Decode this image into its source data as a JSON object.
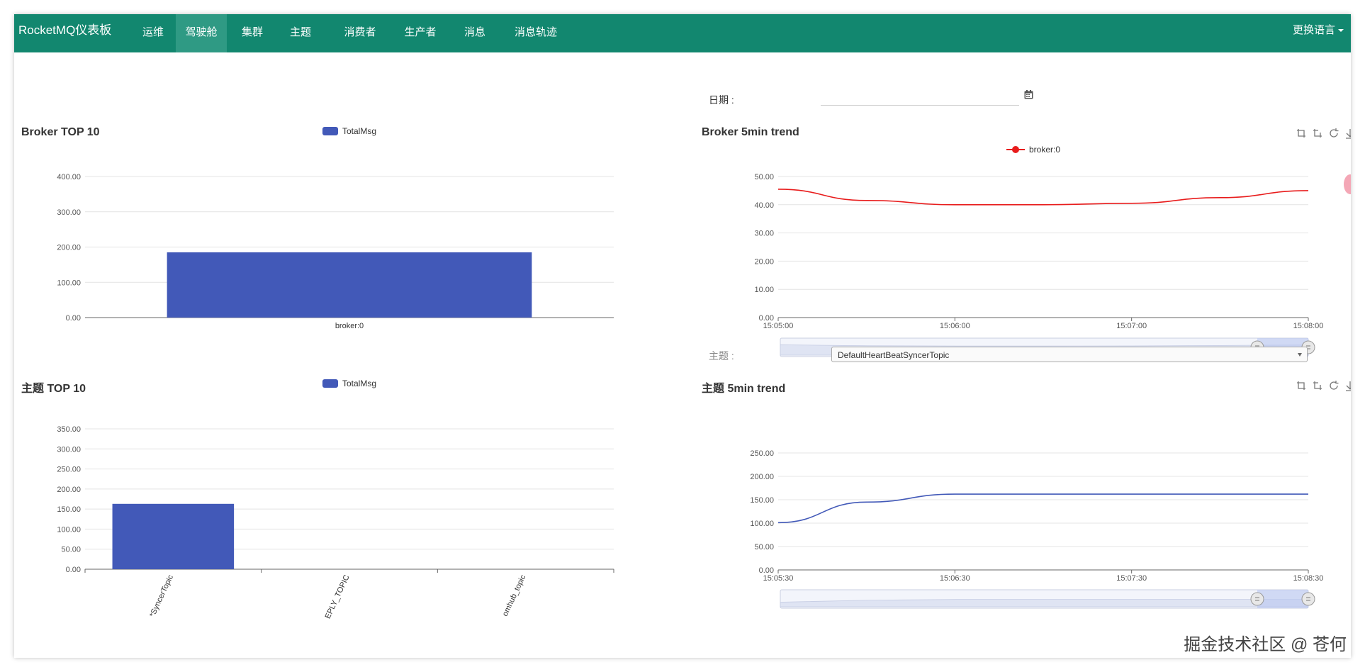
{
  "navbar": {
    "brand": "RocketMQ仪表板",
    "items": [
      {
        "label": "运维"
      },
      {
        "label": "驾驶舱",
        "active": true
      },
      {
        "label": "集群"
      },
      {
        "label": "主题"
      },
      {
        "label": "消费者"
      },
      {
        "label": "生产者"
      },
      {
        "label": "消息"
      },
      {
        "label": "消息轨迹"
      }
    ],
    "language_label": "更换语言"
  },
  "date_filter": {
    "label": "日期 :",
    "value": "",
    "icon": "calendar-icon"
  },
  "topic_filter": {
    "label": "主题 :",
    "selected": "DefaultHeartBeatSyncerTopic"
  },
  "colors": {
    "navbar": "#12876f",
    "nav_active": "#2f9a84",
    "bar": "#4259b8",
    "broker_trend_line": "#e81c1c",
    "topic_trend_line": "#4259b8"
  },
  "toolbox_icons": [
    "zoom-icon",
    "zoom-reset-icon",
    "restore-icon",
    "save-image-icon"
  ],
  "watermark": "掘金技术社区 @ 苍何",
  "chart_data": [
    {
      "id": "broker_top10",
      "type": "bar",
      "title": "Broker TOP 10",
      "legend": "TotalMsg",
      "categories": [
        "broker:0"
      ],
      "values": [
        185
      ],
      "ylim": [
        0,
        400
      ],
      "yticks": [
        "0.00",
        "100.00",
        "200.00",
        "300.00",
        "400.00"
      ],
      "legend_position": "top-center"
    },
    {
      "id": "broker_trend",
      "type": "line",
      "title": "Broker 5min trend",
      "legend": "broker:0",
      "x": [
        "15:05:00",
        "15:05:30",
        "15:06:00",
        "15:06:30",
        "15:07:00",
        "15:07:30",
        "15:08:00"
      ],
      "values": [
        45.5,
        41.5,
        40,
        40,
        40.5,
        42.5,
        45
      ],
      "xticks": [
        "15:05:00",
        "15:06:00",
        "15:07:00",
        "15:08:00"
      ],
      "ylim": [
        0,
        50
      ],
      "yticks": [
        "0.00",
        "10.00",
        "20.00",
        "30.00",
        "40.00",
        "50.00"
      ],
      "data_zoom": true,
      "legend_position": "top-center"
    },
    {
      "id": "topic_top10",
      "type": "bar",
      "title": "主题 TOP 10",
      "legend": "TotalMsg",
      "categories": [
        "*SyncerTopic",
        "EPLY_TOPIC",
        "omhub_topic"
      ],
      "values": [
        163,
        0,
        0
      ],
      "ylim": [
        0,
        350
      ],
      "yticks": [
        "0.00",
        "50.00",
        "100.00",
        "150.00",
        "200.00",
        "250.00",
        "300.00",
        "350.00"
      ],
      "rotated_labels": true,
      "legend_position": "top-center"
    },
    {
      "id": "topic_trend",
      "type": "line",
      "title": "主题 5min trend",
      "x": [
        "15:05:30",
        "15:06:00",
        "15:06:30",
        "15:07:00",
        "15:07:30",
        "15:08:00",
        "15:08:30"
      ],
      "values": [
        101,
        145,
        162,
        162,
        162,
        162,
        162
      ],
      "xticks": [
        "15:05:30",
        "15:06:30",
        "15:07:30",
        "15:08:30"
      ],
      "ylim": [
        0,
        250
      ],
      "yticks": [
        "0.00",
        "50.00",
        "100.00",
        "150.00",
        "200.00",
        "250.00"
      ],
      "data_zoom": true
    }
  ]
}
